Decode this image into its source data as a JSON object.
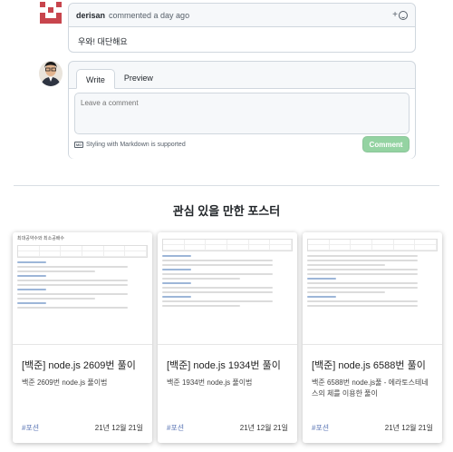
{
  "comment": {
    "author": "derisan",
    "meta": "commented a day ago",
    "body": "우와! 대단해요",
    "reaction_label": "+"
  },
  "editor": {
    "tabs": [
      "Write",
      "Preview"
    ],
    "placeholder": "Leave a comment",
    "markdown_note": "Styling with Markdown is supported",
    "markdown_badge": "MD",
    "submit_label": "Comment"
  },
  "section": {
    "title": "관심 있을 만한 포스터"
  },
  "cards": [
    {
      "thumb_heading": "최대공약수와 최소공배수",
      "title": "[백준] node.js 2609번 풀이",
      "desc": "백준 2609번 node.js 풀이법",
      "tag": "#포션",
      "date": "21년 12월 21일"
    },
    {
      "thumb_heading": "",
      "title": "[백준] node.js 1934번 풀이",
      "desc": "백준 1934번 node.js 풀이법",
      "tag": "#포션",
      "date": "21년 12월 21일"
    },
    {
      "thumb_heading": "",
      "title": "[백준] node.js 6588번 풀이",
      "desc": "백준 6588번 node.js풀 - 에라토스테네스의 체를 이용한 풀이",
      "tag": "#포션",
      "date": "21년 12월 21일"
    }
  ],
  "colors": {
    "comment_button": "#94d3a2",
    "tag": "#5b76b5",
    "avatar_identicon": "#c8454d"
  }
}
